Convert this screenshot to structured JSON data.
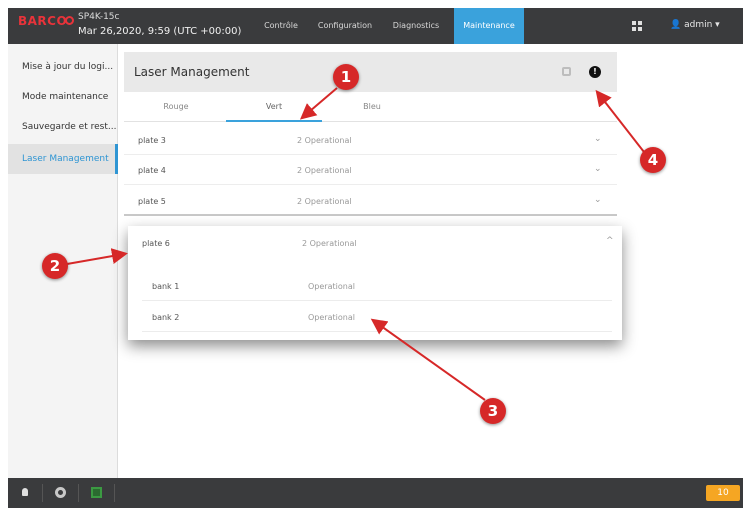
{
  "header": {
    "brand": "BARCO",
    "device_name": "SP4K-15c",
    "datetime": "Mar 26,2020, 9:59 (UTC +00:00)",
    "tabs": [
      {
        "label": "Contrôle"
      },
      {
        "label": "Configuration"
      },
      {
        "label": "Diagnostics"
      },
      {
        "label": "Maintenance",
        "active": true
      }
    ],
    "user": "admin ▾"
  },
  "sidebar": {
    "items": [
      {
        "label": "Mise à jour du logi..."
      },
      {
        "label": "Mode maintenance"
      },
      {
        "label": "Sauvegarde et rest..."
      },
      {
        "label": "Laser Management",
        "active": true
      }
    ]
  },
  "panel": {
    "title": "Laser Management",
    "info_glyph": "!",
    "color_tabs": [
      {
        "label": "Rouge"
      },
      {
        "label": "Vert",
        "active": true
      },
      {
        "label": "Bleu"
      }
    ],
    "plates": [
      {
        "name": "plate 3",
        "status": "2 Operational",
        "chevron": "⌄"
      },
      {
        "name": "plate 4",
        "status": "2 Operational",
        "chevron": "⌄"
      },
      {
        "name": "plate 5",
        "status": "2 Operational",
        "chevron": "⌄"
      }
    ],
    "expanded_plate": {
      "name": "plate 6",
      "status": "2 Operational",
      "chevron": "^",
      "banks": [
        {
          "name": "bank 1",
          "status": "Operational"
        },
        {
          "name": "bank 2",
          "status": "Operational"
        }
      ]
    }
  },
  "footer": {
    "notification_count": "10"
  },
  "callouts": [
    "1",
    "2",
    "3",
    "4"
  ],
  "colors": {
    "accent": "#3aa2dc",
    "brand": "#e8333a",
    "callout": "#d62828",
    "badge": "#f5a623",
    "status_ok": "#3b9a42"
  }
}
